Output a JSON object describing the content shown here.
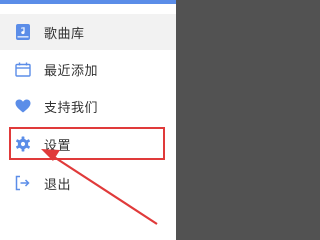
{
  "colors": {
    "accent": "#5b8de8",
    "overlay": "#525252",
    "highlight": "#e03a3a",
    "selected_bg": "#f2f2f2"
  },
  "menu": {
    "items": [
      {
        "label": "歌曲库",
        "icon": "music-library-icon"
      },
      {
        "label": "最近添加",
        "icon": "calendar-icon"
      },
      {
        "label": "支持我们",
        "icon": "heart-icon"
      },
      {
        "label": "设置",
        "icon": "gear-icon"
      },
      {
        "label": "退出",
        "icon": "logout-icon"
      }
    ]
  }
}
